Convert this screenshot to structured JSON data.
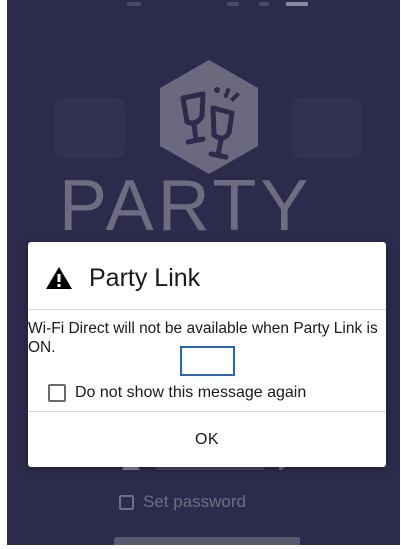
{
  "background_app": {
    "logo_word": "PARTY",
    "set_password_label": "Set password"
  },
  "dialog": {
    "title": "Party Link",
    "title_icon": "warning-icon",
    "message": "Wi-Fi Direct will not be available when Party Link is ON.",
    "dont_show_label": "Do not show this message again",
    "dont_show_checked": false,
    "ok_label": "OK"
  },
  "colors": {
    "screen_bg": "#2d2b4c",
    "dialog_bg": "#ffffff",
    "focus_outline": "#2a64b4",
    "text": "#1a1a1a"
  }
}
